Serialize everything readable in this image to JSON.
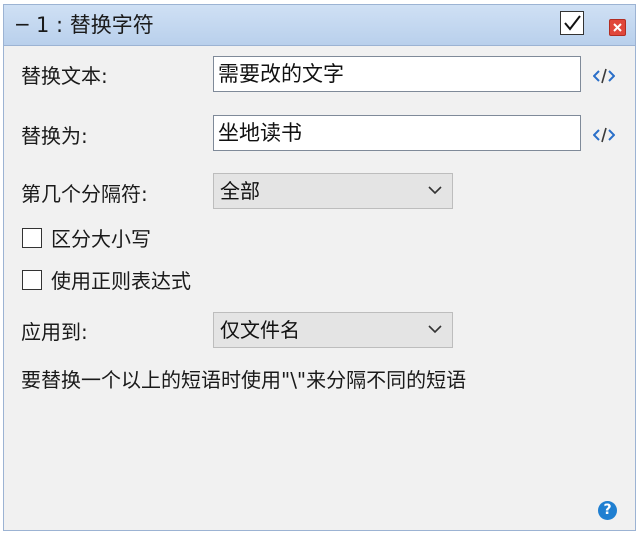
{
  "titlebar": {
    "collapse_glyph": "−",
    "title": "1 : 替换字符",
    "enabled": true
  },
  "form": {
    "replace_text_label": "替换文本:",
    "replace_text_value": "需要改的文字",
    "replace_with_label": "替换为:",
    "replace_with_value": "坐地读书",
    "separator_label": "第几个分隔符:",
    "separator_value": "全部",
    "case_sensitive_label": "区分大小写",
    "case_sensitive_checked": false,
    "regex_label": "使用正则表达式",
    "regex_checked": false,
    "apply_to_label": "应用到:",
    "apply_to_value": "仅文件名",
    "hint": "要替换一个以上的短语时使用\"\\\"来分隔不同的短语"
  },
  "icons": {
    "code": "code-icon",
    "chevron": "chevron-down-icon",
    "help": "help-icon",
    "close": "close-icon",
    "check": "checkmark-icon"
  },
  "colors": {
    "titlebar": "#c5d9f1",
    "panel": "#f1f1f1",
    "close": "#e0473b",
    "help": "#1f7fd1",
    "code_icon": "#2a6fc9"
  }
}
